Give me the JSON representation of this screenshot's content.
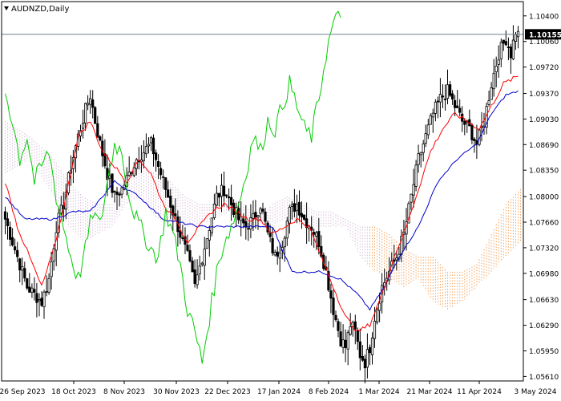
{
  "chart_data": {
    "type": "candlestick",
    "title": "AUDNZD,Daily",
    "symbol": "AUDNZD",
    "timeframe": "Daily",
    "current_price": "1.10155",
    "ylim": [
      1.0555,
      1.1059
    ],
    "y_ticks": [
      "1.10400",
      "1.10060",
      "1.09720",
      "1.09370",
      "1.09030",
      "1.08690",
      "1.08350",
      "1.08000",
      "1.07660",
      "1.07320",
      "1.06980",
      "1.06630",
      "1.06290",
      "1.05950",
      "1.05610"
    ],
    "x_ticks": [
      "26 Sep 2023",
      "18 Oct 2023",
      "8 Nov 2023",
      "30 Nov 2023",
      "22 Dec 2023",
      "17 Jan 2024",
      "8 Feb 2024",
      "1 Mar 2024",
      "21 Mar 2024",
      "11 Apr 2024",
      "3 May 2024"
    ],
    "grid": false,
    "colors": {
      "background": "#ffffff",
      "candles": "#000000",
      "tenkan": "#ff0000",
      "kijun": "#0000cd",
      "chikou": "#00cc00",
      "cloud_bullish": "#f4a460",
      "cloud_bearish": "#d8bfd8",
      "current_price_line": "#708090",
      "price_label_bg": "#000000"
    },
    "close_anchors": [
      [
        0,
        1.077
      ],
      [
        3,
        1.074
      ],
      [
        6,
        1.071
      ],
      [
        9,
        1.068
      ],
      [
        12,
        1.067
      ],
      [
        15,
        1.066
      ],
      [
        18,
        1.069
      ],
      [
        21,
        1.076
      ],
      [
        24,
        1.079
      ],
      [
        27,
        1.084
      ],
      [
        30,
        1.088
      ],
      [
        33,
        1.0915
      ],
      [
        35,
        1.0935
      ],
      [
        37,
        1.09
      ],
      [
        39,
        1.087
      ],
      [
        42,
        1.083
      ],
      [
        45,
        1.08
      ],
      [
        48,
        1.081
      ],
      [
        51,
        1.083
      ],
      [
        54,
        1.085
      ],
      [
        57,
        1.086
      ],
      [
        60,
        1.087
      ],
      [
        63,
        1.084
      ],
      [
        66,
        1.081
      ],
      [
        69,
        1.078
      ],
      [
        72,
        1.075
      ],
      [
        75,
        1.072
      ],
      [
        78,
        1.068
      ],
      [
        81,
        1.072
      ],
      [
        84,
        1.076
      ],
      [
        87,
        1.08
      ],
      [
        90,
        1.081
      ],
      [
        93,
        1.079
      ],
      [
        96,
        1.077
      ],
      [
        99,
        1.076
      ],
      [
        102,
        1.077
      ],
      [
        105,
        1.079
      ],
      [
        108,
        1.075
      ],
      [
        111,
        1.072
      ],
      [
        114,
        1.074
      ],
      [
        117,
        1.078
      ],
      [
        120,
        1.079
      ],
      [
        123,
        1.077
      ],
      [
        126,
        1.076
      ],
      [
        129,
        1.074
      ],
      [
        132,
        1.07
      ],
      [
        135,
        1.065
      ],
      [
        138,
        1.061
      ],
      [
        140,
        1.06
      ],
      [
        142,
        1.063
      ],
      [
        144,
        1.062
      ],
      [
        146,
        1.059
      ],
      [
        148,
        1.058
      ],
      [
        150,
        1.06
      ],
      [
        152,
        1.064
      ],
      [
        155,
        1.068
      ],
      [
        158,
        1.07
      ],
      [
        161,
        1.072
      ],
      [
        164,
        1.075
      ],
      [
        167,
        1.08
      ],
      [
        170,
        1.085
      ],
      [
        173,
        1.088
      ],
      [
        176,
        1.091
      ],
      [
        179,
        1.093
      ],
      [
        182,
        1.094
      ],
      [
        185,
        1.092
      ],
      [
        188,
        1.09
      ],
      [
        191,
        1.089
      ],
      [
        194,
        1.087
      ],
      [
        197,
        1.09
      ],
      [
        200,
        1.095
      ],
      [
        203,
        1.099
      ],
      [
        206,
        1.101
      ],
      [
        208,
        1.099
      ],
      [
        210,
        1.102
      ],
      [
        211,
        1.1015
      ]
    ],
    "n_bars": 212,
    "kijun_anchors": [
      [
        0,
        1.08
      ],
      [
        8,
        1.077
      ],
      [
        20,
        1.077
      ],
      [
        28,
        1.078
      ],
      [
        35,
        1.078
      ],
      [
        45,
        1.082
      ],
      [
        55,
        1.08
      ],
      [
        65,
        1.077
      ],
      [
        80,
        1.076
      ],
      [
        95,
        1.076
      ],
      [
        110,
        1.076
      ],
      [
        118,
        1.07
      ],
      [
        125,
        1.07
      ],
      [
        130,
        1.07
      ],
      [
        138,
        1.069
      ],
      [
        145,
        1.067
      ],
      [
        150,
        1.065
      ],
      [
        156,
        1.068
      ],
      [
        162,
        1.072
      ],
      [
        170,
        1.076
      ],
      [
        178,
        1.082
      ],
      [
        186,
        1.085
      ],
      [
        194,
        1.087
      ],
      [
        200,
        1.091
      ],
      [
        206,
        1.0935
      ],
      [
        211,
        1.094
      ]
    ],
    "tenkan_anchors": [
      [
        0,
        1.082
      ],
      [
        5,
        1.076
      ],
      [
        10,
        1.072
      ],
      [
        15,
        1.068
      ],
      [
        20,
        1.073
      ],
      [
        25,
        1.08
      ],
      [
        30,
        1.088
      ],
      [
        35,
        1.09
      ],
      [
        40,
        1.086
      ],
      [
        45,
        1.084
      ],
      [
        50,
        1.082
      ],
      [
        55,
        1.085
      ],
      [
        60,
        1.083
      ],
      [
        65,
        1.079
      ],
      [
        70,
        1.077
      ],
      [
        75,
        1.074
      ],
      [
        80,
        1.076
      ],
      [
        85,
        1.078
      ],
      [
        90,
        1.079
      ],
      [
        95,
        1.078
      ],
      [
        100,
        1.077
      ],
      [
        105,
        1.077
      ],
      [
        110,
        1.075
      ],
      [
        115,
        1.076
      ],
      [
        120,
        1.077
      ],
      [
        125,
        1.076
      ],
      [
        130,
        1.072
      ],
      [
        135,
        1.068
      ],
      [
        140,
        1.064
      ],
      [
        145,
        1.062
      ],
      [
        150,
        1.063
      ],
      [
        155,
        1.067
      ],
      [
        160,
        1.072
      ],
      [
        165,
        1.076
      ],
      [
        170,
        1.081
      ],
      [
        175,
        1.086
      ],
      [
        180,
        1.089
      ],
      [
        185,
        1.091
      ],
      [
        190,
        1.09
      ],
      [
        195,
        1.089
      ],
      [
        200,
        1.092
      ],
      [
        205,
        1.095
      ],
      [
        211,
        1.096
      ]
    ],
    "chikou_anchors": [
      [
        0,
        1.094
      ],
      [
        3,
        1.09
      ],
      [
        6,
        1.085
      ],
      [
        9,
        1.088
      ],
      [
        12,
        1.082
      ],
      [
        15,
        1.084
      ],
      [
        18,
        1.086
      ],
      [
        21,
        1.08
      ],
      [
        24,
        1.076
      ],
      [
        27,
        1.072
      ],
      [
        30,
        1.069
      ],
      [
        33,
        1.073
      ],
      [
        36,
        1.078
      ],
      [
        39,
        1.076
      ],
      [
        42,
        1.082
      ],
      [
        45,
        1.087
      ],
      [
        48,
        1.086
      ],
      [
        51,
        1.08
      ],
      [
        54,
        1.077
      ],
      [
        57,
        1.075
      ],
      [
        60,
        1.073
      ],
      [
        63,
        1.072
      ],
      [
        66,
        1.078
      ],
      [
        69,
        1.075
      ],
      [
        72,
        1.071
      ],
      [
        75,
        1.065
      ],
      [
        78,
        1.062
      ],
      [
        81,
        1.058
      ],
      [
        84,
        1.064
      ],
      [
        87,
        1.07
      ],
      [
        90,
        1.074
      ],
      [
        93,
        1.076
      ],
      [
        96,
        1.079
      ],
      [
        99,
        1.083
      ],
      [
        102,
        1.088
      ],
      [
        105,
        1.086
      ],
      [
        108,
        1.09
      ],
      [
        111,
        1.089
      ],
      [
        114,
        1.092
      ],
      [
        117,
        1.095
      ],
      [
        120,
        1.092
      ],
      [
        123,
        1.089
      ],
      [
        126,
        1.088
      ],
      [
        129,
        1.093
      ],
      [
        132,
        1.099
      ],
      [
        135,
        1.103
      ],
      [
        138,
        1.104
      ]
    ],
    "cloud_anchors": [
      [
        0,
        1.083,
        1.09
      ],
      [
        10,
        1.085,
        1.088
      ],
      [
        20,
        1.08,
        1.085
      ],
      [
        26,
        1.076,
        1.082
      ],
      [
        32,
        1.074,
        1.08
      ],
      [
        38,
        1.075,
        1.079
      ],
      [
        44,
        1.076,
        1.079
      ],
      [
        50,
        1.079,
        1.083
      ],
      [
        56,
        1.08,
        1.084
      ],
      [
        62,
        1.077,
        1.083
      ],
      [
        68,
        1.076,
        1.082
      ],
      [
        74,
        1.076,
        1.08
      ],
      [
        80,
        1.076,
        1.079
      ],
      [
        86,
        1.077,
        1.079
      ],
      [
        92,
        1.078,
        1.08
      ],
      [
        98,
        1.077,
        1.079
      ],
      [
        104,
        1.076,
        1.077
      ],
      [
        110,
        1.076,
        1.079
      ],
      [
        116,
        1.077,
        1.08
      ],
      [
        122,
        1.076,
        1.079
      ],
      [
        128,
        1.076,
        1.078
      ],
      [
        134,
        1.076,
        1.078
      ],
      [
        140,
        1.076,
        1.077
      ],
      [
        146,
        1.072,
        1.076
      ],
      [
        152,
        1.07,
        1.076
      ],
      [
        158,
        1.069,
        1.075
      ],
      [
        164,
        1.068,
        1.073
      ],
      [
        170,
        1.069,
        1.072
      ],
      [
        176,
        1.066,
        1.072
      ],
      [
        182,
        1.065,
        1.07
      ],
      [
        188,
        1.066,
        1.07
      ],
      [
        194,
        1.068,
        1.071
      ],
      [
        200,
        1.07,
        1.075
      ],
      [
        206,
        1.072,
        1.079
      ],
      [
        212,
        1.074,
        1.081
      ],
      [
        218,
        1.076,
        1.082
      ],
      [
        224,
        1.079,
        1.084
      ],
      [
        230,
        1.081,
        1.085
      ],
      [
        236,
        1.083,
        1.086
      ]
    ],
    "cloud_bullish_from_bar": 150
  }
}
